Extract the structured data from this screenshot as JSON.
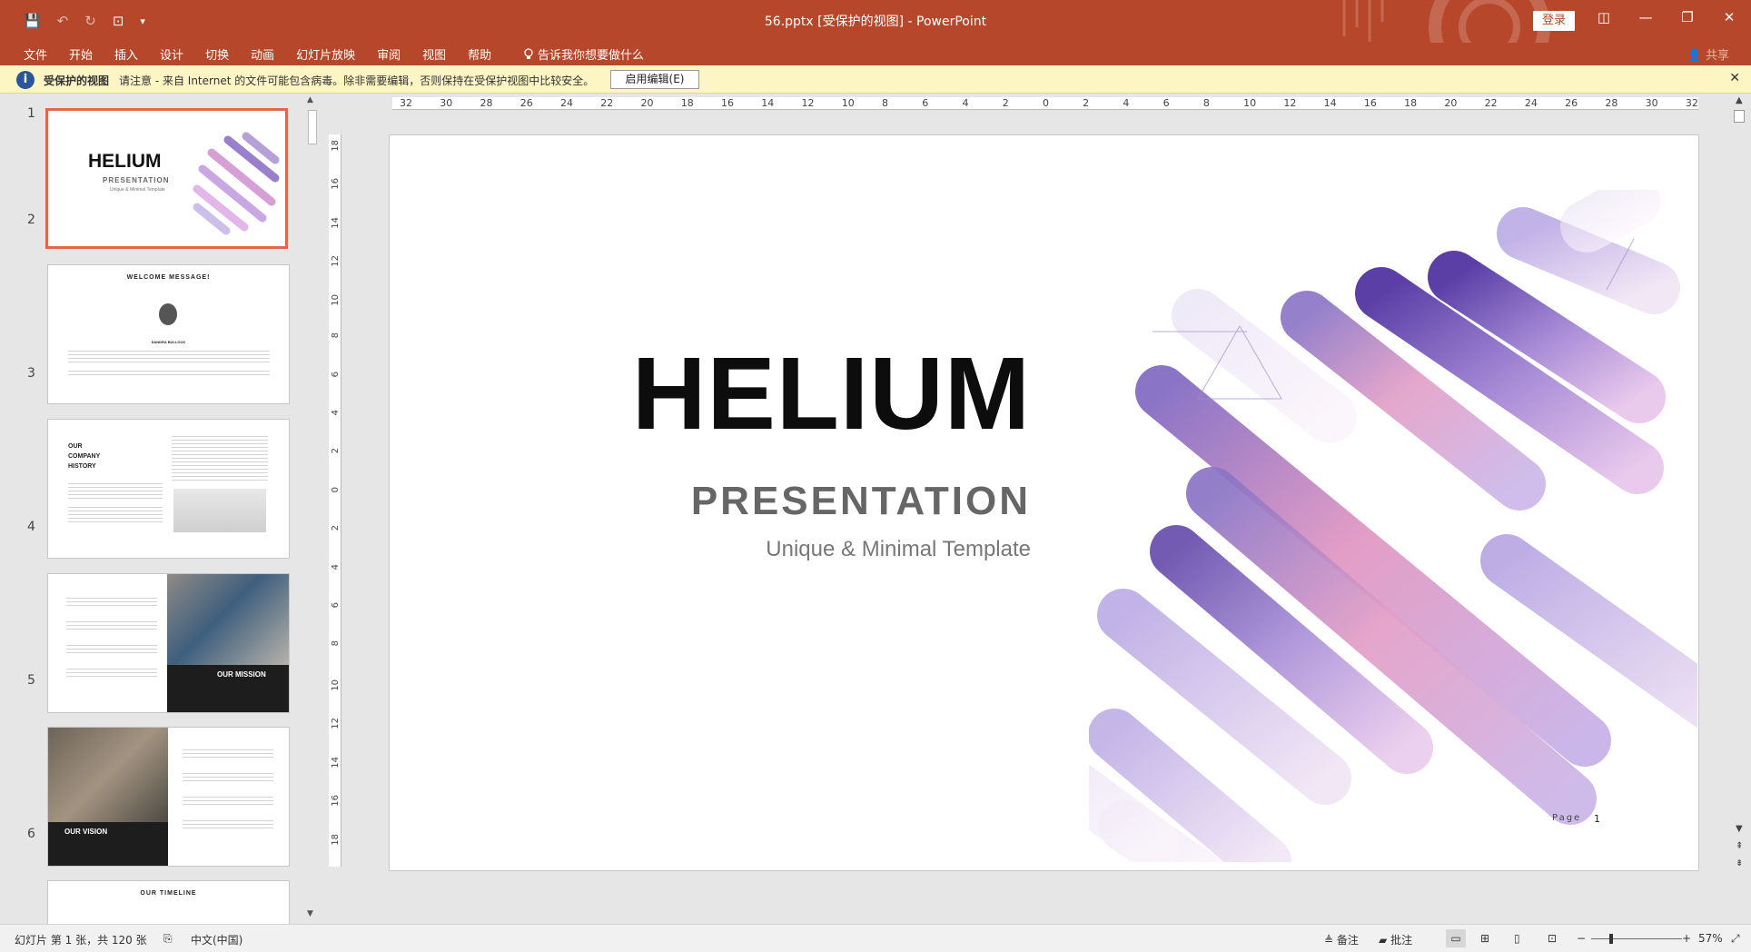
{
  "window": {
    "title": "56.pptx [受保护的视图]  -  PowerPoint",
    "login": "登录",
    "minimize": "—",
    "restore": "❐",
    "close": "✕",
    "ribbon_display": "◫"
  },
  "quick_access": {
    "save": "💾",
    "undo": "↶",
    "redo": "↻",
    "present": "⊡",
    "more": "▾"
  },
  "ribbon": {
    "tabs": [
      "文件",
      "开始",
      "插入",
      "设计",
      "切换",
      "动画",
      "幻灯片放映",
      "审阅",
      "视图",
      "帮助"
    ],
    "tell_me": "告诉我你想要做什么",
    "share": "共享"
  },
  "protected": {
    "title": "受保护的视图",
    "message": "请注意 - 来自 Internet 的文件可能包含病毒。除非需要编辑，否则保持在受保护视图中比较安全。",
    "enable_button": "启用编辑(E)",
    "close": "✕"
  },
  "thumbnails": {
    "numbers": [
      "1",
      "2",
      "3",
      "4",
      "5",
      "6"
    ],
    "t1_title": "HELIUM",
    "t1_sub": "PRESENTATION",
    "t1_tag": "Unique & Minimal Template",
    "t2_title": "WELCOME MESSAGE!",
    "t2_name": "SANDRA BULLOCK",
    "t3_title_1": "OUR",
    "t3_title_2": "COMPANY",
    "t3_title_3": "HISTORY",
    "t4_title": "OUR MISSION",
    "t5_title": "OUR VISION",
    "t6_title": "OUR TIMELINE"
  },
  "ruler": {
    "h_ticks": [
      "32",
      "30",
      "28",
      "26",
      "24",
      "22",
      "20",
      "18",
      "16",
      "14",
      "12",
      "10",
      "8",
      "6",
      "4",
      "2",
      "0",
      "2",
      "4",
      "6",
      "8",
      "10",
      "12",
      "14",
      "16",
      "18",
      "20",
      "22",
      "24",
      "26",
      "28",
      "30",
      "32"
    ],
    "v_ticks": [
      "18",
      "16",
      "14",
      "12",
      "10",
      "8",
      "6",
      "4",
      "2",
      "0",
      "2",
      "4",
      "6",
      "8",
      "10",
      "12",
      "14",
      "16",
      "18"
    ]
  },
  "slide": {
    "title": "HELIUM",
    "subtitle": "PRESENTATION",
    "tagline": "Unique & Minimal Template",
    "page_label": "Page",
    "page_number": "1"
  },
  "status": {
    "slide_info": "幻灯片 第 1 张，共 120 张",
    "language": "中文(中国)",
    "notes": "备注",
    "comments": "批注",
    "zoom": "57%",
    "zoom_minus": "−",
    "zoom_plus": "+"
  },
  "colors": {
    "accent": "#b7472a",
    "selected_thumb": "#e3664a",
    "protected_bar": "#fdf5c4"
  }
}
